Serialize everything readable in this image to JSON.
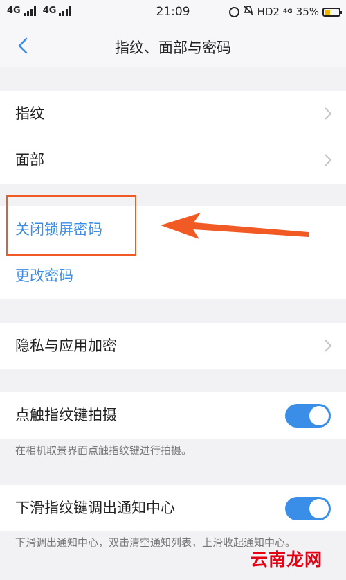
{
  "statusbar": {
    "net1": "4G",
    "net2": "4G",
    "time": "21:09",
    "hd": "HD2",
    "lte": "4G",
    "battery": "35%",
    "battery_level": 0.35,
    "icons": [
      "alarm-icon",
      "mute-icon",
      "battery-icon"
    ]
  },
  "header": {
    "title": "指纹、面部与密码",
    "back_icon": "chevron-left-icon"
  },
  "group1": {
    "items": [
      {
        "label": "指纹"
      },
      {
        "label": "面部"
      }
    ]
  },
  "group2": {
    "items": [
      {
        "label": "关闭锁屏密码"
      },
      {
        "label": "更改密码"
      }
    ]
  },
  "group3": {
    "items": [
      {
        "label": "隐私与应用加密"
      }
    ]
  },
  "group4": {
    "label": "点触指纹键拍摄",
    "enabled": true,
    "description": "在相机取景界面点触指纹键进行拍摄。"
  },
  "group5": {
    "label": "下滑指纹键调出通知中心",
    "enabled": true,
    "description": "下滑调出通知中心，双击清空通知列表，上滑收起通知中心。"
  },
  "watermark": {
    "text": "云南龙网"
  },
  "colors": {
    "accent": "#3b8ee8",
    "annotation": "#f15a24",
    "background": "#f2f2f5"
  }
}
